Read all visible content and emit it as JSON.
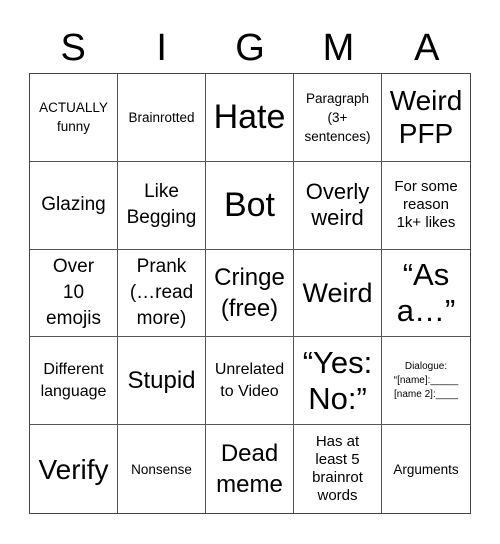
{
  "title_letters": [
    "S",
    "I",
    "G",
    "M",
    "A"
  ],
  "board": {
    "rows": [
      [
        "ACTUALLY funny",
        "Brainrotted",
        "Hate",
        "Paragraph (3+ sentences)",
        "Weird PFP"
      ],
      [
        "Glazing",
        "Like Begging",
        "Bot",
        "Overly weird",
        "For some reason 1k+ likes"
      ],
      [
        "Over 10 emojis",
        "Prank (…read more)",
        "Cringe (free)",
        "Weird",
        "“As a…”"
      ],
      [
        "Different language",
        "Stupid",
        "Unrelated to Video",
        "“Yes: No:”",
        "Dialogue: “[name]:_____ [name 2]:____"
      ],
      [
        "Verify",
        "Nonsense",
        "Dead meme",
        "Has at least 5 brainrot words",
        "Arguments"
      ]
    ],
    "display_lines": [
      [
        "ACTUALLY\nfunny",
        "Brainrotted",
        "Hate",
        "Paragraph\n(3+\nsentences)",
        "Weird\nPFP"
      ],
      [
        "Glazing",
        "Like\nBegging",
        "Bot",
        "Overly\nweird",
        "For some\nreason\n1k+ likes"
      ],
      [
        "Over\n10\nemojis",
        "Prank\n(…read\nmore)",
        "Cringe\n(free)",
        "Weird",
        "“As\na…”"
      ],
      [
        "Different\nlanguage",
        "Stupid",
        "Unrelated\nto Video",
        "“Yes:\nNo:”",
        "Dialogue:\n“[name]:_____\n[name 2]:____"
      ],
      [
        "Verify",
        "Nonsense",
        "Dead\nmeme",
        "Has at\nleast 5\nbrainrot\nwords",
        "Arguments"
      ]
    ]
  },
  "colors": {
    "text": "#000000",
    "background": "#ffffff",
    "grid_lines": "#555555"
  }
}
